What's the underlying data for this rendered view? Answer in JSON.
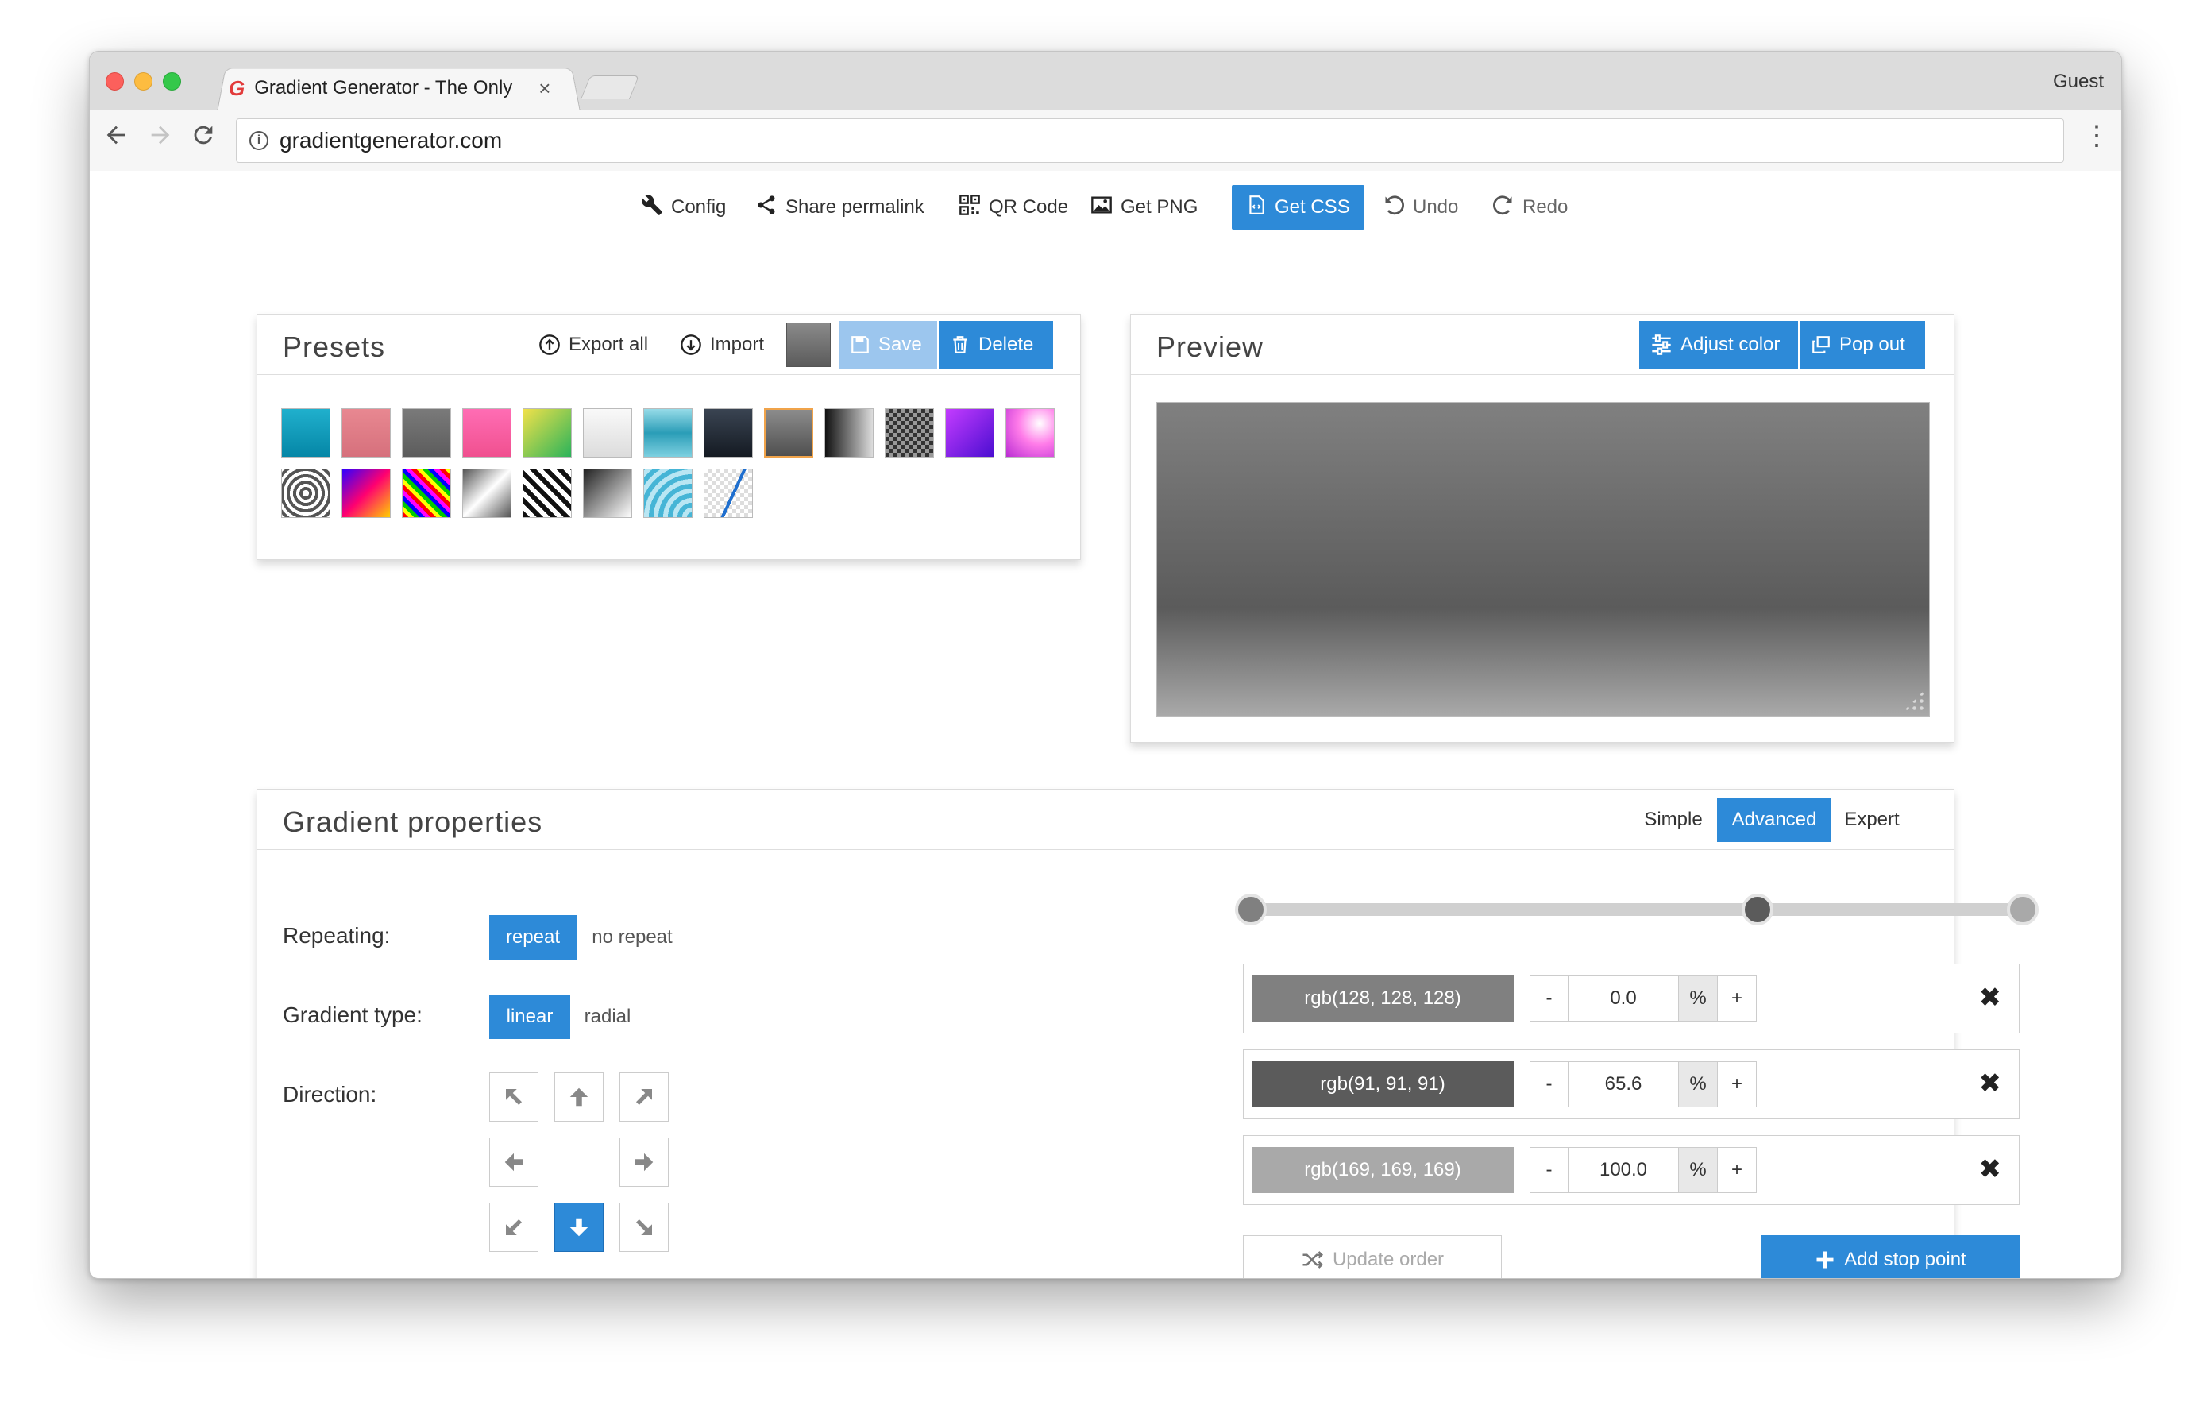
{
  "browser": {
    "tab_title": "Gradient Generator - The Only",
    "tab_close": "×",
    "profile": "Guest",
    "url": "gradientgenerator.com",
    "menu_glyph": "⋮"
  },
  "toolbar": {
    "config": "Config",
    "share": "Share permalink",
    "qr": "QR Code",
    "png": "Get PNG",
    "css": "Get CSS",
    "undo": "Undo",
    "redo": "Redo"
  },
  "presets": {
    "title": "Presets",
    "export_all": "Export all",
    "import": "Import",
    "save": "Save",
    "delete": "Delete"
  },
  "preview": {
    "title": "Preview",
    "adjust_color": "Adjust color",
    "pop_out": "Pop out"
  },
  "gradient": {
    "title": "Gradient properties",
    "modes": [
      "Simple",
      "Advanced",
      "Expert"
    ],
    "active_mode": "Advanced",
    "repeating_label": "Repeating:",
    "repeat": "repeat",
    "no_repeat": "no repeat",
    "type_label": "Gradient type:",
    "linear": "linear",
    "radial": "radial",
    "direction_label": "Direction:",
    "active_direction": "down",
    "stops": [
      {
        "color": "rgb(128, 128, 128)",
        "position": "0.0",
        "unit": "%",
        "minus": "-",
        "plus": "+",
        "remove": "✖",
        "hex": "#808080"
      },
      {
        "color": "rgb(91, 91, 91)",
        "position": "65.6",
        "unit": "%",
        "minus": "-",
        "plus": "+",
        "remove": "✖",
        "hex": "#5b5b5b"
      },
      {
        "color": "rgb(169, 169, 169)",
        "position": "100.0",
        "unit": "%",
        "minus": "-",
        "plus": "+",
        "remove": "✖",
        "hex": "#a9a9a9"
      }
    ],
    "update_order": "Update order",
    "add_stop": "Add stop point"
  },
  "colors": {
    "accent": "#2d8ad8",
    "accent_light": "#9cc6ee"
  }
}
